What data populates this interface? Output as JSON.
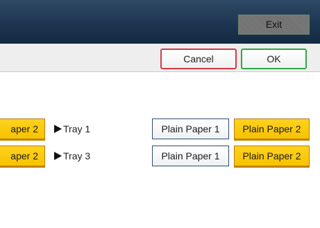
{
  "header": {
    "exit_label": "Exit"
  },
  "actions": {
    "cancel_label": "Cancel",
    "ok_label": "OK"
  },
  "rows": [
    {
      "left_option_label": "aper 2",
      "tray_label": "Tray 1",
      "options": [
        "Plain Paper 1",
        "Plain Paper 2"
      ],
      "selected_option": "Plain Paper 2"
    },
    {
      "left_option_label": "aper 2",
      "tray_label": "Tray 3",
      "options": [
        "Plain Paper 1",
        "Plain Paper 2"
      ],
      "selected_option": "Plain Paper 2"
    }
  ],
  "colors": {
    "header_bg": "#1d3550",
    "selected_bg": "#f7c300",
    "cancel_border": "#d23a48",
    "ok_border": "#2da845"
  },
  "icons": {
    "tray_marker": "triangle-right-icon"
  }
}
